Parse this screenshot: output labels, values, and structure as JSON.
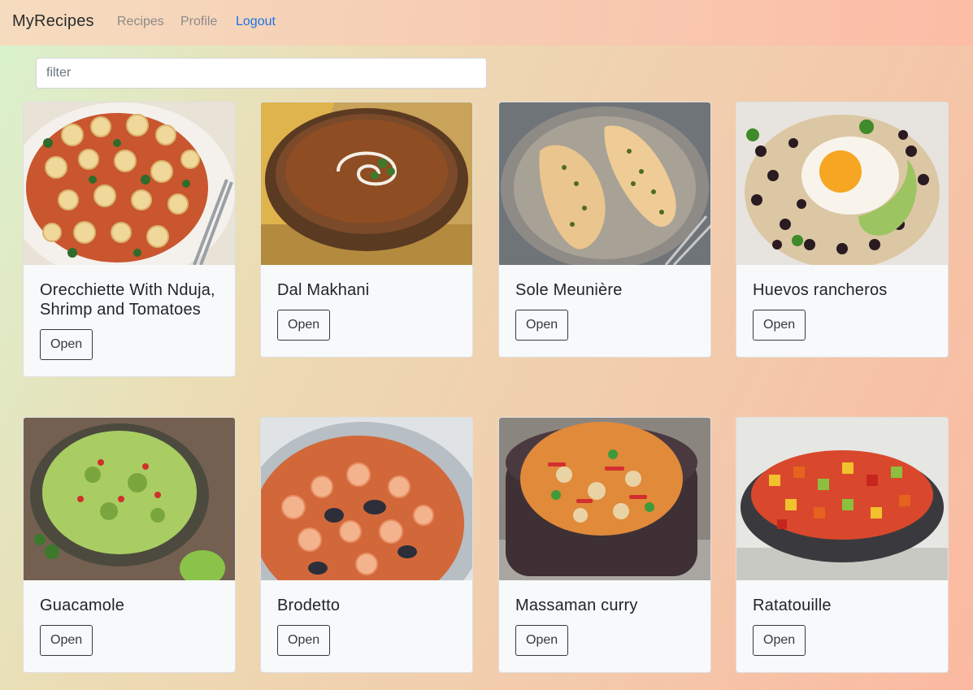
{
  "navbar": {
    "brand": "MyRecipes",
    "links": [
      {
        "label": "Recipes"
      },
      {
        "label": "Profile"
      },
      {
        "label": "Logout"
      }
    ]
  },
  "filter": {
    "placeholder": "filter",
    "value": ""
  },
  "recipes": [
    {
      "title": "Orecchiette With Nduja, Shrimp and Tomatoes",
      "button": "Open"
    },
    {
      "title": "Dal Makhani",
      "button": "Open"
    },
    {
      "title": "Sole Meunière",
      "button": "Open"
    },
    {
      "title": "Huevos rancheros",
      "button": "Open"
    },
    {
      "title": "Guacamole",
      "button": "Open"
    },
    {
      "title": "Brodetto",
      "button": "Open"
    },
    {
      "title": "Massaman curry",
      "button": "Open"
    },
    {
      "title": "Ratatouille",
      "button": "Open"
    }
  ]
}
